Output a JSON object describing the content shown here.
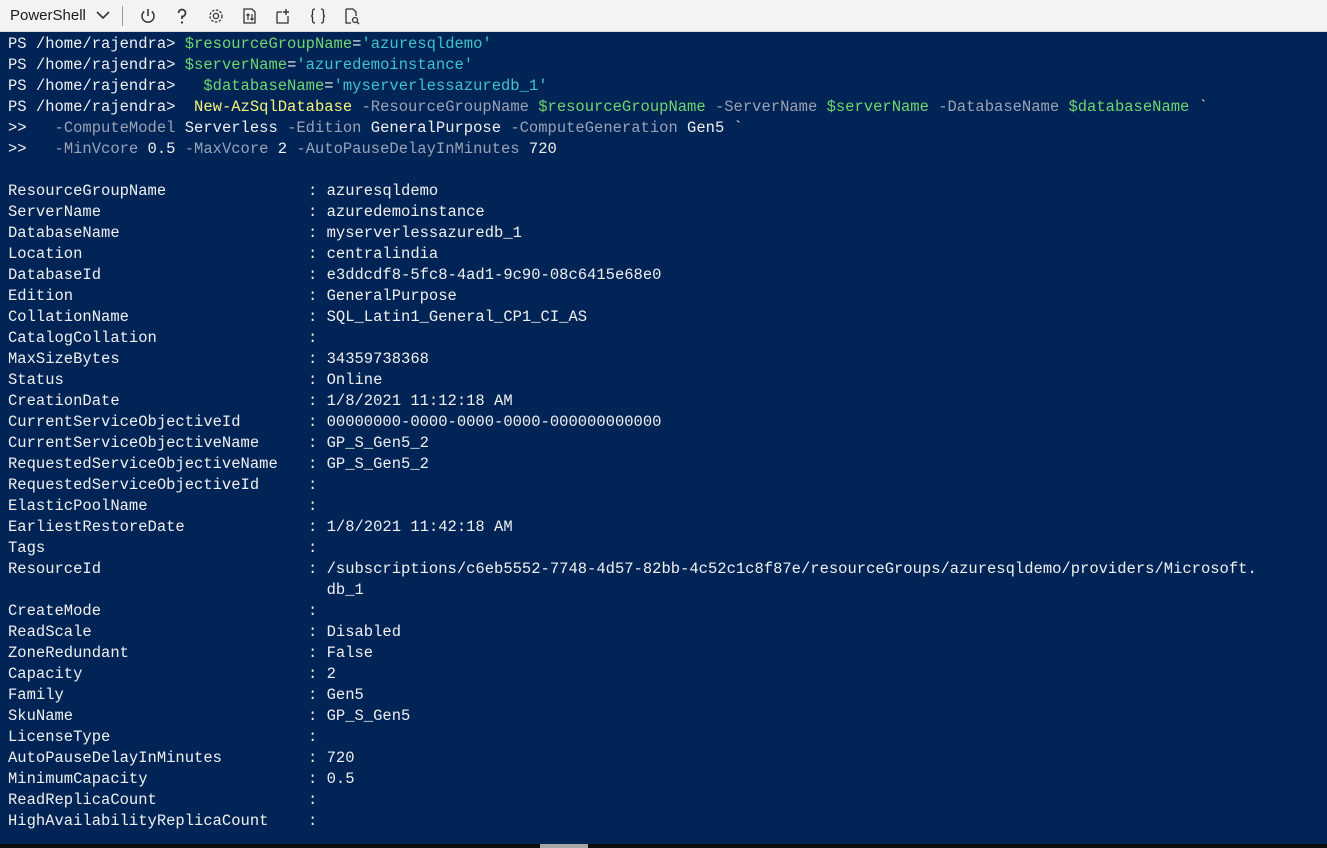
{
  "toolbar": {
    "shell_label": "PowerShell",
    "buttons": [
      {
        "icon": "power-icon",
        "glyph": "⏻"
      },
      {
        "icon": "help-icon",
        "glyph": "?"
      },
      {
        "icon": "gear-icon",
        "glyph": "⚙"
      },
      {
        "icon": "upload-download-icon",
        "glyph": "⇅"
      },
      {
        "icon": "open-new-session-icon",
        "glyph": "☐"
      },
      {
        "icon": "braces-icon",
        "glyph": "{}"
      },
      {
        "icon": "web-preview-icon",
        "glyph": "▤"
      }
    ]
  },
  "terminal": {
    "commands": [
      {
        "prompt": "PS /home/rajendra> ",
        "pre": "",
        "var": "$resourceGroupName",
        "eq": "=",
        "str": "'azuresqldemo'"
      },
      {
        "prompt": "PS /home/rajendra> ",
        "pre": "",
        "var": "$serverName",
        "eq": "=",
        "str": "'azuredemoinstance'"
      },
      {
        "prompt": "PS /home/rajendra> ",
        "pre": "  ",
        "var": "$databaseName",
        "eq": "=",
        "str": "'myserverlessazuredb_1'"
      }
    ],
    "cmd_line": {
      "prompt": "PS /home/rajendra> ",
      "pre": " ",
      "cmdlet": "New-AzSqlDatabase",
      "p1": " -ResourceGroupName ",
      "v1": "$resourceGroupName",
      "p2": " -ServerName ",
      "v2": "$serverName",
      "p3": " -DatabaseName ",
      "v3": "$databaseName",
      "tick": " `"
    },
    "cont1": {
      "prompt": ">>   ",
      "p1": "-ComputeModel",
      "a1": " Serverless ",
      "p2": "-Edition",
      "a2": " GeneralPurpose ",
      "p3": "-ComputeGeneration",
      "a3": " Gen5 `"
    },
    "cont2": {
      "prompt": ">>   ",
      "p1": "-MinVcore",
      "a1": " 0.5 ",
      "p2": "-MaxVcore",
      "a2": " 2 ",
      "p3": "-AutoPauseDelayInMinutes",
      "a3": " 720"
    },
    "output": [
      {
        "key": "ResourceGroupName",
        "val": ": azuresqldemo"
      },
      {
        "key": "ServerName",
        "val": ": azuredemoinstance"
      },
      {
        "key": "DatabaseName",
        "val": ": myserverlessazuredb_1"
      },
      {
        "key": "Location",
        "val": ": centralindia"
      },
      {
        "key": "DatabaseId",
        "val": ": e3ddcdf8-5fc8-4ad1-9c90-08c6415e68e0"
      },
      {
        "key": "Edition",
        "val": ": GeneralPurpose"
      },
      {
        "key": "CollationName",
        "val": ": SQL_Latin1_General_CP1_CI_AS"
      },
      {
        "key": "CatalogCollation",
        "val": ":"
      },
      {
        "key": "MaxSizeBytes",
        "val": ": 34359738368"
      },
      {
        "key": "Status",
        "val": ": Online"
      },
      {
        "key": "CreationDate",
        "val": ": 1/8/2021 11:12:18 AM"
      },
      {
        "key": "CurrentServiceObjectiveId",
        "val": ": 00000000-0000-0000-0000-000000000000"
      },
      {
        "key": "CurrentServiceObjectiveName",
        "val": ": GP_S_Gen5_2"
      },
      {
        "key": "RequestedServiceObjectiveName",
        "val": ": GP_S_Gen5_2"
      },
      {
        "key": "RequestedServiceObjectiveId",
        "val": ":"
      },
      {
        "key": "ElasticPoolName",
        "val": ":"
      },
      {
        "key": "EarliestRestoreDate",
        "val": ": 1/8/2021 11:42:18 AM"
      },
      {
        "key": "Tags",
        "val": ":"
      },
      {
        "key": "ResourceId",
        "val": ": /subscriptions/c6eb5552-7748-4d57-82bb-4c52c1c8f87e/resourceGroups/azuresqldemo/providers/Microsoft."
      },
      {
        "key": "",
        "val": "  db_1"
      },
      {
        "key": "CreateMode",
        "val": ":"
      },
      {
        "key": "ReadScale",
        "val": ": Disabled"
      },
      {
        "key": "ZoneRedundant",
        "val": ": False"
      },
      {
        "key": "Capacity",
        "val": ": 2"
      },
      {
        "key": "Family",
        "val": ": Gen5"
      },
      {
        "key": "SkuName",
        "val": ": GP_S_Gen5"
      },
      {
        "key": "LicenseType",
        "val": ":"
      },
      {
        "key": "AutoPauseDelayInMinutes",
        "val": ": 720"
      },
      {
        "key": "MinimumCapacity",
        "val": ": 0.5"
      },
      {
        "key": "ReadReplicaCount",
        "val": ":"
      },
      {
        "key": "HighAvailabilityReplicaCount",
        "val": ":"
      }
    ]
  }
}
